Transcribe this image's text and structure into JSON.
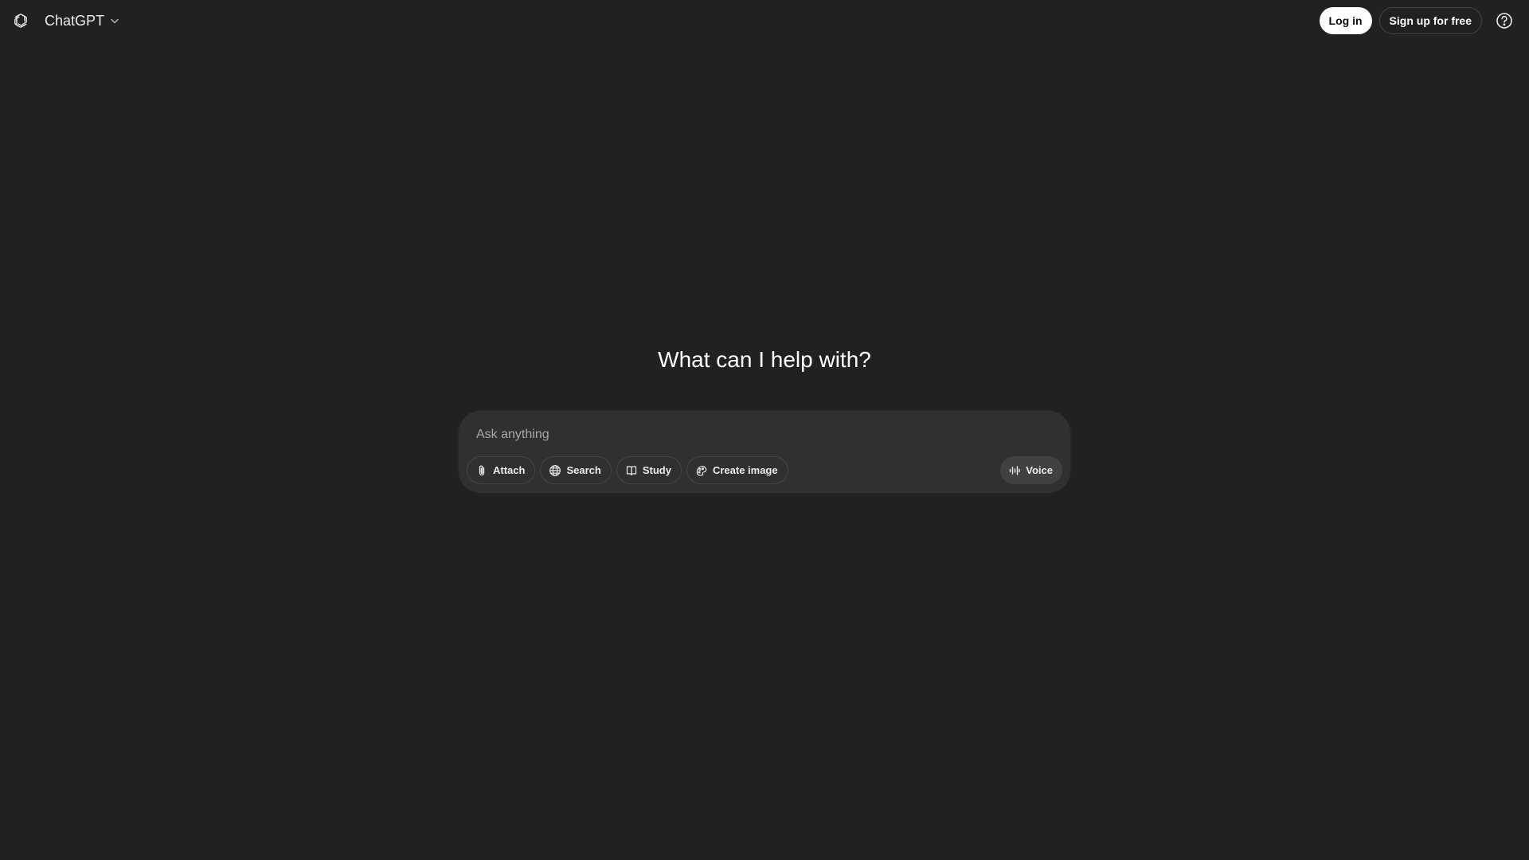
{
  "header": {
    "brand": "ChatGPT",
    "login_label": "Log in",
    "signup_label": "Sign up for free"
  },
  "main": {
    "headline": "What can I help with?"
  },
  "composer": {
    "placeholder": "Ask anything",
    "tools": {
      "attach": "Attach",
      "search": "Search",
      "study": "Study",
      "create_image": "Create image"
    },
    "voice_label": "Voice"
  },
  "icons": {
    "logo": "openai-logo-icon",
    "model_menu": "chevron-down-icon",
    "help": "help-circle-icon",
    "attach": "paperclip-icon",
    "search": "globe-icon",
    "study": "book-icon",
    "create_image": "image-create-icon",
    "voice": "voice-waveform-icon"
  },
  "colors": {
    "background": "#212121",
    "composer": "#303030",
    "text": "#ececec",
    "login_bg": "#ffffff"
  }
}
